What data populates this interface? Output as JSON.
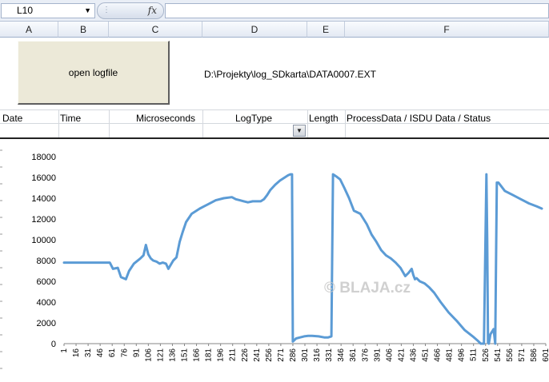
{
  "formula_bar": {
    "name_box": "L10",
    "fx_label": "fx",
    "formula": ""
  },
  "columns": [
    "A",
    "B",
    "C",
    "D",
    "E",
    "F"
  ],
  "button": {
    "label": "open logfile"
  },
  "file_path": "D:\\Projekty\\log_SDkarta\\DATA0007.EXT",
  "table_headers": {
    "date": "Date",
    "time": "Time",
    "microseconds": "Microseconds",
    "logtype": "LogType",
    "length": "Length",
    "processdata": "ProcessData / ISDU Data / Status"
  },
  "watermark": "© BLAJA.cz",
  "chart_data": {
    "type": "line",
    "ylim": [
      0,
      18000
    ],
    "yticks": [
      "0",
      "2000",
      "4000",
      "6000",
      "8000",
      "10000",
      "12000",
      "14000",
      "16000",
      "18000"
    ],
    "xticks": [
      "1",
      "16",
      "31",
      "46",
      "61",
      "76",
      "91",
      "106",
      "121",
      "136",
      "151",
      "166",
      "181",
      "196",
      "211",
      "226",
      "241",
      "256",
      "271",
      "286",
      "301",
      "316",
      "331",
      "346",
      "361",
      "376",
      "391",
      "406",
      "421",
      "436",
      "451",
      "466",
      "481",
      "496",
      "511",
      "526",
      "541",
      "556",
      "571",
      "586",
      "601"
    ],
    "series_color": "#5b9bd5",
    "x": [
      1,
      10,
      20,
      30,
      40,
      50,
      58,
      62,
      68,
      72,
      78,
      82,
      88,
      96,
      100,
      103,
      106,
      109,
      112,
      116,
      120,
      124,
      128,
      131,
      134,
      137,
      141,
      145,
      149,
      153,
      160,
      170,
      180,
      190,
      200,
      210,
      215,
      220,
      225,
      230,
      236,
      242,
      246,
      250,
      254,
      258,
      264,
      270,
      276,
      280,
      283,
      285,
      286,
      290,
      295,
      300,
      305,
      310,
      318,
      325,
      330,
      334,
      336,
      338,
      340,
      345,
      350,
      356,
      362,
      370,
      378,
      384,
      390,
      396,
      402,
      408,
      414,
      420,
      426,
      430,
      434,
      436,
      438,
      440,
      444,
      450,
      456,
      462,
      470,
      480,
      490,
      500,
      510,
      516,
      520,
      524,
      527,
      528,
      529,
      530,
      532,
      536,
      538,
      540,
      542,
      544,
      550,
      560,
      570,
      580,
      590,
      596
    ],
    "y": [
      7800,
      7800,
      7800,
      7800,
      7800,
      7800,
      7800,
      7200,
      7300,
      6400,
      6200,
      7000,
      7700,
      8200,
      8500,
      9500,
      8600,
      8200,
      8000,
      7900,
      7700,
      7800,
      7700,
      7200,
      7600,
      8000,
      8300,
      9800,
      10800,
      11700,
      12500,
      13000,
      13400,
      13800,
      14000,
      14100,
      13900,
      13800,
      13700,
      13600,
      13700,
      13700,
      13700,
      13900,
      14300,
      14800,
      15300,
      15700,
      16000,
      16200,
      16300,
      16300,
      200,
      500,
      600,
      700,
      750,
      750,
      700,
      600,
      600,
      700,
      16300,
      16200,
      16100,
      15800,
      15000,
      14000,
      12800,
      12500,
      11500,
      10500,
      9800,
      9000,
      8500,
      8200,
      7800,
      7300,
      6500,
      6800,
      7200,
      6600,
      6200,
      6300,
      6000,
      5800,
      5400,
      4900,
      4000,
      3000,
      2200,
      1300,
      700,
      300,
      0,
      0,
      16300,
      10000,
      100,
      0,
      900,
      1400,
      0,
      15500,
      15500,
      15300,
      14700,
      14300,
      13900,
      13500,
      13200,
      13000
    ]
  }
}
